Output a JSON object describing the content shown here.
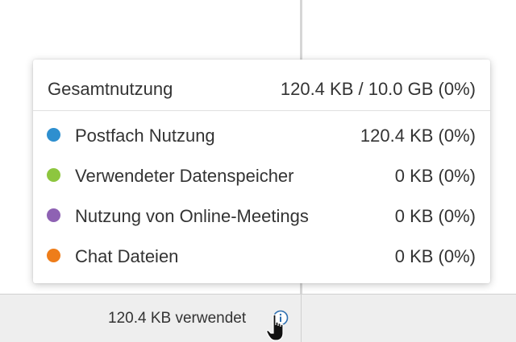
{
  "popover": {
    "total_label": "Gesamtnutzung",
    "total_value": "120.4 KB / 10.0 GB (0%)",
    "items": [
      {
        "label": "Postfach Nutzung",
        "value": "120.4 KB (0%)",
        "color": "#2e8fcf"
      },
      {
        "label": "Verwendeter Datenspeicher",
        "value": "0 KB (0%)",
        "color": "#8dc63f"
      },
      {
        "label": "Nutzung von Online-Meetings",
        "value": "0 KB (0%)",
        "color": "#8e62b3"
      },
      {
        "label": "Chat Dateien",
        "value": "0 KB (0%)",
        "color": "#ee7d1a"
      }
    ]
  },
  "footer": {
    "usage_label": "120.4 KB verwendet",
    "info_icon": "info-icon",
    "accent_color": "#2e6fb0"
  }
}
